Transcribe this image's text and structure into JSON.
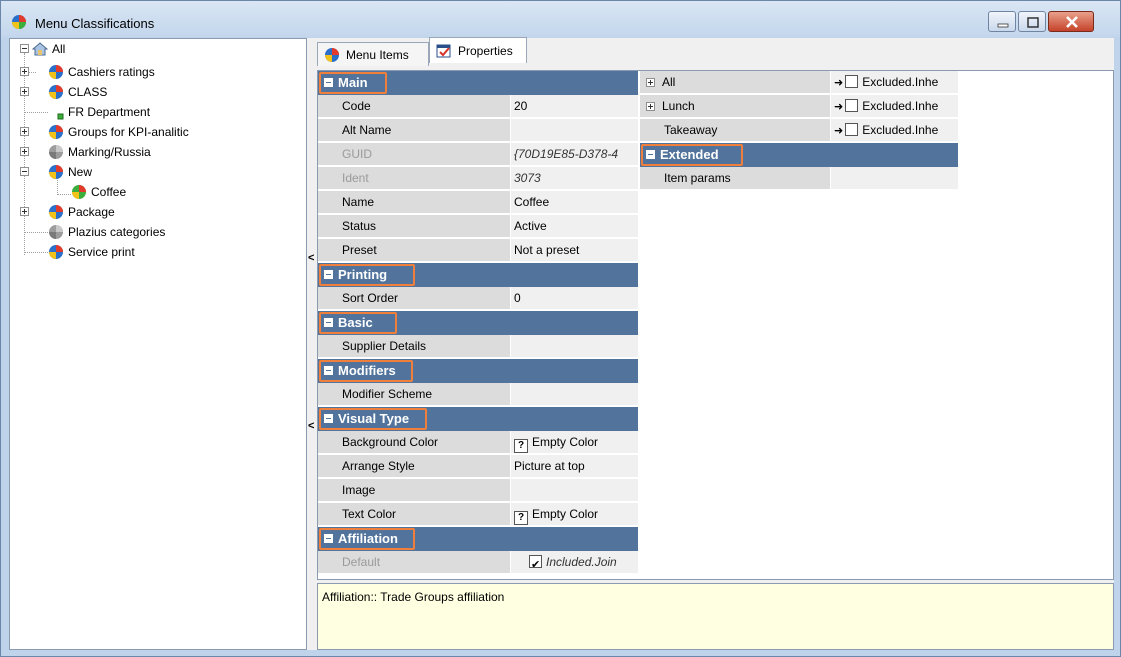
{
  "window": {
    "title": "Menu Classifications"
  },
  "tree": {
    "root": "All",
    "items": [
      {
        "label": "Cashiers ratings"
      },
      {
        "label": "CLASS"
      },
      {
        "label": "FR Department"
      },
      {
        "label": "Groups for KPI-analitic"
      },
      {
        "label": "Marking/Russia"
      },
      {
        "label": "New"
      },
      {
        "label": "Coffee"
      },
      {
        "label": "Package"
      },
      {
        "label": "Plazius categories"
      },
      {
        "label": "Service print"
      }
    ]
  },
  "tabs": [
    {
      "label": "Menu Items"
    },
    {
      "label": "Properties"
    }
  ],
  "properties": {
    "main": {
      "label": "Main"
    },
    "code": {
      "name": "Code",
      "value": "20"
    },
    "alt_name": {
      "name": "Alt Name",
      "value": ""
    },
    "guid": {
      "name": "GUID",
      "value": "{70D19E85-D378-4"
    },
    "ident": {
      "name": "Ident",
      "value": "3073"
    },
    "name": {
      "name": "Name",
      "value": "Coffee"
    },
    "status": {
      "name": "Status",
      "value": "Active"
    },
    "preset": {
      "name": "Preset",
      "value": "Not a preset"
    },
    "printing": {
      "label": "Printing"
    },
    "sort_order": {
      "name": "Sort Order",
      "value": "0"
    },
    "basic": {
      "label": "Basic"
    },
    "supplier_details": {
      "name": "Supplier Details",
      "value": ""
    },
    "modifiers": {
      "label": "Modifiers"
    },
    "modifier_scheme": {
      "name": "Modifier Scheme",
      "value": ""
    },
    "visual_type": {
      "label": "Visual Type"
    },
    "background_color": {
      "name": "Background Color",
      "value": "Empty Color"
    },
    "arrange_style": {
      "name": "Arrange Style",
      "value": "Picture at top"
    },
    "image": {
      "name": "Image",
      "value": ""
    },
    "text_color": {
      "name": "Text Color",
      "value": "Empty Color"
    },
    "affiliation": {
      "label": "Affiliation"
    },
    "default": {
      "name": "Default",
      "value": "Included.Join"
    }
  },
  "right_grid": {
    "all": {
      "name": "All",
      "value": "Excluded.Inhe"
    },
    "lunch": {
      "name": "Lunch",
      "value": "Excluded.Inhe"
    },
    "takeaway": {
      "name": "Takeaway",
      "value": "Excluded.Inhe"
    },
    "extended": {
      "label": "Extended"
    },
    "item_params": {
      "name": "Item params",
      "value": ""
    }
  },
  "description": {
    "text": "Affiliation:: Trade Groups affiliation"
  },
  "colors": {
    "category_header": "#52749c",
    "highlight": "#ef7f3a",
    "description_bg": "#ffffe1"
  }
}
